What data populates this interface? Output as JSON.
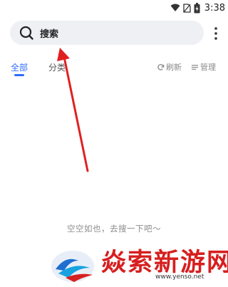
{
  "status_bar": {
    "time": "3:38",
    "icons": [
      "wifi-icon",
      "no-sim-icon",
      "battery-icon"
    ]
  },
  "search": {
    "label": "搜索",
    "icon": "search-icon"
  },
  "menu": {
    "icon": "more-vertical-icon"
  },
  "tabs": [
    {
      "label": "全部",
      "active": true
    },
    {
      "label": "分类",
      "active": false
    }
  ],
  "actions": {
    "refresh_label": "刷新",
    "manage_label": "管理"
  },
  "empty_state": {
    "message": "空空如也，去搜一下吧～"
  },
  "annotation": {
    "color": "#e02020"
  },
  "watermark": {
    "title": "焱索新游网",
    "url": "www.yenso.net"
  },
  "colors": {
    "accent": "#2f6bff",
    "search_background": "#eef0f4",
    "muted_text": "#8c8c8c",
    "watermark_red": "#d61f1f"
  }
}
